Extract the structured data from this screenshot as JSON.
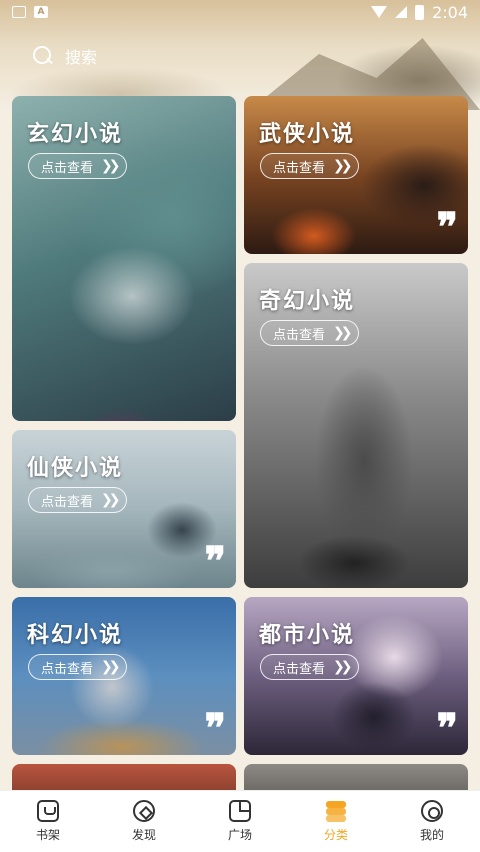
{
  "status_bar": {
    "time": "2:04"
  },
  "search": {
    "label": "搜索"
  },
  "cards": [
    {
      "title": "玄幻小说",
      "button": "点击查看",
      "quote": ""
    },
    {
      "title": "武侠小说",
      "button": "点击查看",
      "quote": "❞"
    },
    {
      "title": "奇幻小说",
      "button": "点击查看",
      "quote": ""
    },
    {
      "title": "仙侠小说",
      "button": "点击查看",
      "quote": "❞"
    },
    {
      "title": "科幻小说",
      "button": "点击查看",
      "quote": "❞"
    },
    {
      "title": "都市小说",
      "button": "点击查看",
      "quote": "❞"
    }
  ],
  "nav": [
    {
      "label": "书架",
      "icon": "bookshelf-icon"
    },
    {
      "label": "发现",
      "icon": "compass-icon"
    },
    {
      "label": "广场",
      "icon": "square-icon"
    },
    {
      "label": "分类",
      "icon": "category-icon",
      "active": true
    },
    {
      "label": "我的",
      "icon": "settings-icon"
    }
  ],
  "colors": {
    "accent": "#f4a623"
  }
}
